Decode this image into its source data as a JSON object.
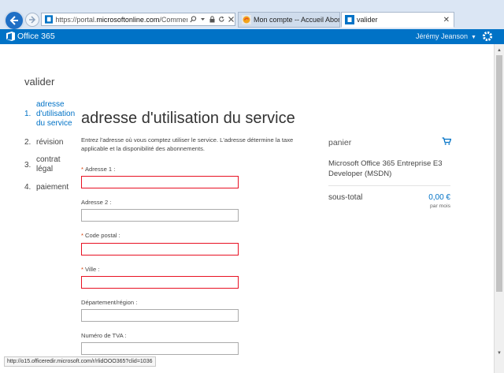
{
  "browser": {
    "url_prefix": "https://portal.",
    "url_domain": "microsoftonline.com",
    "url_path": "/Commerce/Pur",
    "tabs": [
      {
        "label": "Mon compte -- Accueil Abonn..."
      },
      {
        "label": "valider"
      }
    ],
    "status_url": "http://o15.officeredir.microsoft.com/r/rlidOOO365?clid=1036"
  },
  "header": {
    "brand": "Office 365",
    "user": "Jérémy Jeanson",
    "accent_color": "#0072c6"
  },
  "page": {
    "heading": "valider",
    "steps": [
      {
        "num": "1.",
        "label": "adresse d'utilisation du service",
        "active": true
      },
      {
        "num": "2.",
        "label": "révision",
        "active": false
      },
      {
        "num": "3.",
        "label": "contrat légal",
        "active": false
      },
      {
        "num": "4.",
        "label": "paiement",
        "active": false
      }
    ],
    "title": "adresse d'utilisation du service",
    "intro": "Entrez l'adresse où vous comptez utiliser le service. L'adresse détermine la taxe applicable et la disponibilité des abonnements.",
    "fields": [
      {
        "label": "Adresse 1 :",
        "required": true,
        "value": "",
        "error": true
      },
      {
        "label": "Adresse 2 :",
        "required": false,
        "value": "",
        "error": false
      },
      {
        "label": "Code postal :",
        "required": true,
        "value": "",
        "error": true
      },
      {
        "label": "Ville :",
        "required": true,
        "value": "",
        "error": true
      },
      {
        "label": "Département/région :",
        "required": false,
        "value": "",
        "error": false
      },
      {
        "label": "Numéro de TVA :",
        "required": false,
        "value": "",
        "error": false
      }
    ]
  },
  "cart": {
    "title": "panier",
    "product": "Microsoft Office 365 Entreprise E3 Developer (MSDN)",
    "subtotal_label": "sous-total",
    "subtotal_value": "0,00 €",
    "subtotal_period": "par mois"
  }
}
